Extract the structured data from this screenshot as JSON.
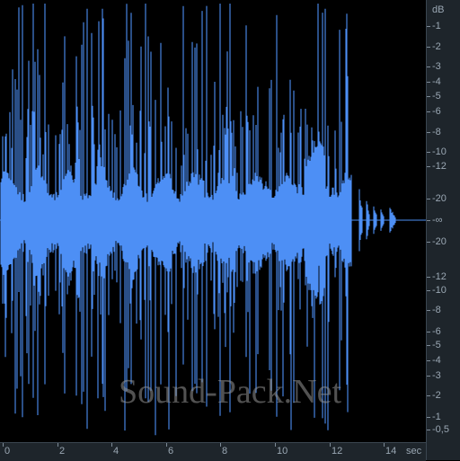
{
  "waveform": {
    "color": "#4d8ff5",
    "background": "#000000",
    "duration_sec": 15,
    "audio_end_sec": 12.9
  },
  "db_axis": {
    "unit": "dB",
    "top_labels": [
      "-1",
      "-2",
      "-3",
      "-4",
      "-5",
      "-6",
      "-8",
      "-10",
      "-12",
      "-20"
    ],
    "center_label": "-∞",
    "bottom_labels": [
      "-20",
      "-12",
      "-10",
      "-8",
      "-6",
      "-5",
      "-4",
      "-3",
      "-2",
      "-1",
      "-0,5"
    ]
  },
  "time_axis": {
    "unit": "sec",
    "labels": [
      "0",
      "2",
      "4",
      "6",
      "8",
      "10",
      "12",
      "14"
    ]
  },
  "watermark": "Sound-Pack.Net"
}
